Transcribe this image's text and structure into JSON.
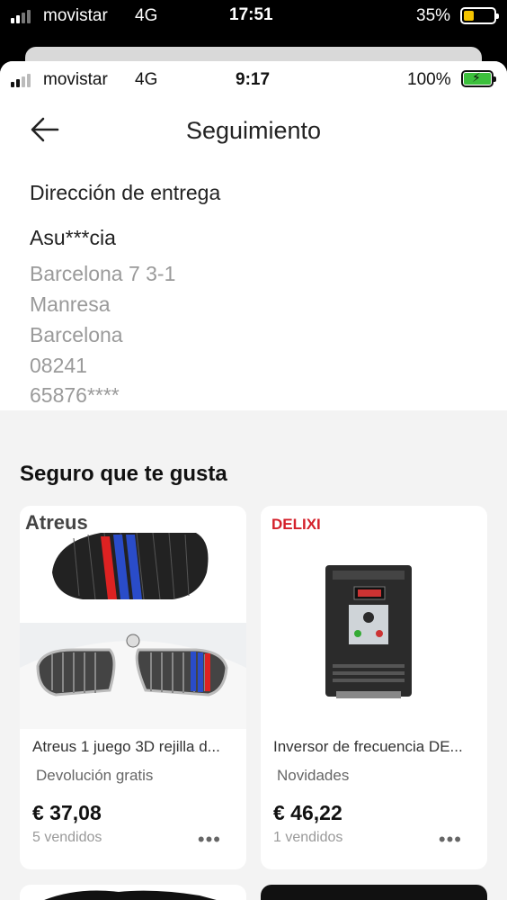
{
  "outer_status": {
    "carrier": "movistar",
    "network": "4G",
    "time": "17:51",
    "battery": "35%"
  },
  "inner_status": {
    "carrier": "movistar",
    "network": "4G",
    "time": "9:17",
    "battery": "100%"
  },
  "header": {
    "title": "Seguimiento",
    "back_icon": "arrow-left-icon"
  },
  "address": {
    "label": "Dirección de entrega",
    "name": "Asu***cia",
    "lines": [
      "Barcelona 7 3-1",
      "Manresa",
      "Barcelona",
      "08241",
      "65876****"
    ]
  },
  "recommendations": {
    "title": "Seguro que te gusta",
    "products": [
      {
        "brand": "Atreus",
        "name": "Atreus 1 juego 3D rejilla d...",
        "tag": "Devolución gratis",
        "price": "€ 37,08",
        "sold": "5 vendidos"
      },
      {
        "brand": "DELIXI",
        "name": "Inversor de frecuencia DE...",
        "tag": "Novidades",
        "price": "€ 46,22",
        "sold": "1 vendidos"
      }
    ],
    "more_label": "•••"
  },
  "colors": {
    "accent_battery_low": "#f5c400",
    "battery_charged": "#3cc03c",
    "delixi_red": "#d4202a"
  }
}
